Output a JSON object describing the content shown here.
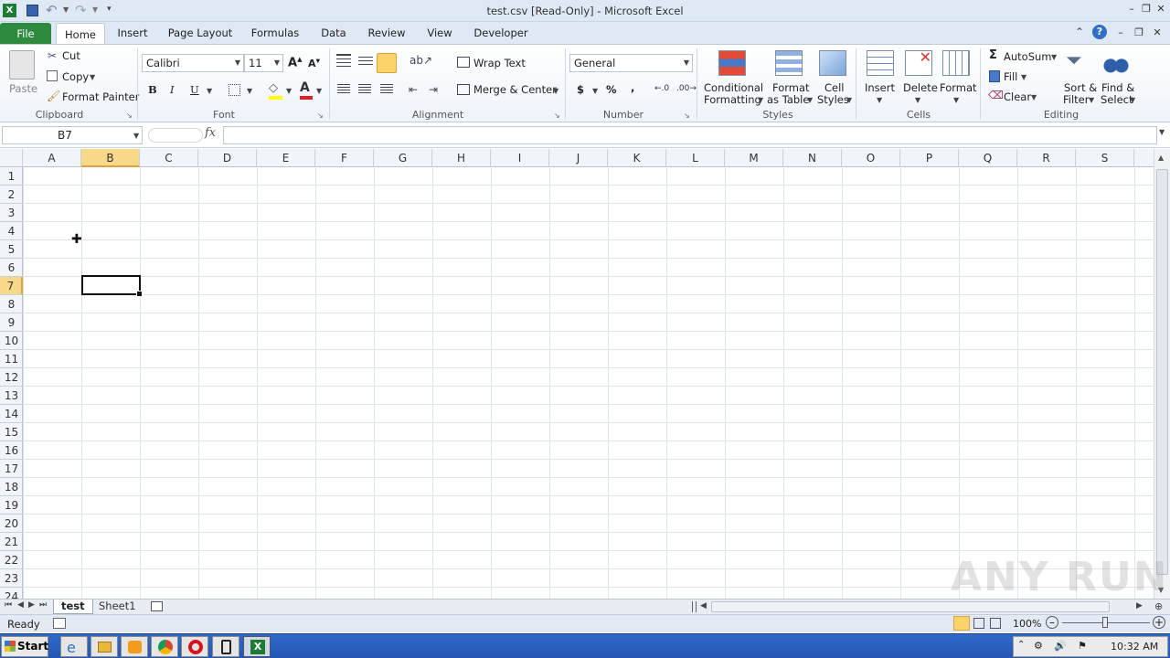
{
  "window": {
    "title": "test.csv  [Read-Only] - Microsoft Excel"
  },
  "tabs": {
    "file": "File",
    "home": "Home",
    "insert": "Insert",
    "page_layout": "Page Layout",
    "formulas": "Formulas",
    "data": "Data",
    "review": "Review",
    "view": "View",
    "developer": "Developer"
  },
  "clipboard": {
    "paste": "Paste",
    "cut": "Cut",
    "copy": "Copy",
    "format_painter": "Format Painter",
    "label": "Clipboard"
  },
  "font": {
    "name": "Calibri",
    "size": "11",
    "bold": "B",
    "italic": "I",
    "underline": "U",
    "label": "Font"
  },
  "alignment": {
    "wrap_text": "Wrap Text",
    "merge_center": "Merge & Center",
    "label": "Alignment"
  },
  "number": {
    "format": "General",
    "currency": "$",
    "percent": "%",
    "comma": ",",
    "label": "Number"
  },
  "styles": {
    "conditional_1": "Conditional",
    "conditional_2": "Formatting",
    "format_table_1": "Format",
    "format_table_2": "as Table",
    "cell_styles_1": "Cell",
    "cell_styles_2": "Styles",
    "label": "Styles"
  },
  "cells": {
    "insert": "Insert",
    "delete": "Delete",
    "format": "Format",
    "label": "Cells"
  },
  "editing": {
    "autosum": "AutoSum",
    "fill": "Fill",
    "clear": "Clear",
    "sort_1": "Sort &",
    "sort_2": "Filter",
    "find_1": "Find &",
    "find_2": "Select",
    "label": "Editing"
  },
  "formula_bar": {
    "name_box": "B7",
    "fx": "fx",
    "value": ""
  },
  "columns": [
    "A",
    "B",
    "C",
    "D",
    "E",
    "F",
    "G",
    "H",
    "I",
    "J",
    "K",
    "L",
    "M",
    "N",
    "O",
    "P",
    "Q",
    "R",
    "S"
  ],
  "rows": [
    "1",
    "2",
    "3",
    "4",
    "5",
    "6",
    "7",
    "8",
    "9",
    "10",
    "11",
    "12",
    "13",
    "14",
    "15",
    "16",
    "17",
    "18",
    "19",
    "20",
    "21",
    "22",
    "23",
    "24"
  ],
  "active_cell": {
    "column": "B",
    "row": "7"
  },
  "sheets": [
    "test",
    "Sheet1"
  ],
  "status": {
    "ready": "Ready",
    "zoom": "100%"
  },
  "taskbar": {
    "start": "Start",
    "clock": "10:32 AM"
  },
  "watermark": "ANY RUN",
  "colors": {
    "file_tab": "#2d8a3e",
    "selection_header": "#f8d98a",
    "taskbar": "#2457b3"
  }
}
